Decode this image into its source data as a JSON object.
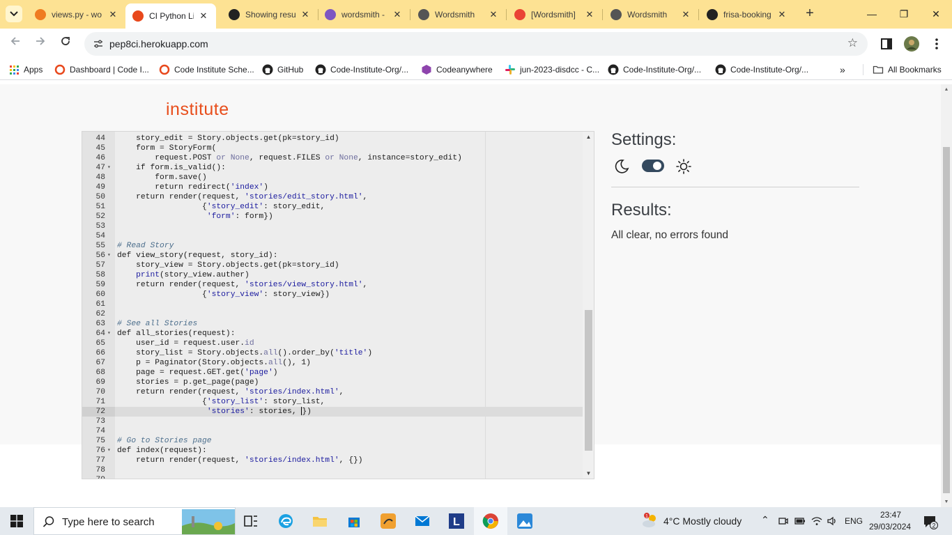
{
  "browser": {
    "tabs": [
      {
        "title": "views.py - wo",
        "favicon_color": "#ef7b21",
        "active": false
      },
      {
        "title": "CI Python Lin",
        "favicon_color": "#e8481c",
        "active": true
      },
      {
        "title": "Showing resu",
        "favicon_color": "#222222",
        "active": false
      },
      {
        "title": "wordsmith -",
        "favicon_color": "#7e57c2",
        "active": false
      },
      {
        "title": "Wordsmith",
        "favicon_color": "#555555",
        "active": false
      },
      {
        "title": "[Wordsmith]",
        "favicon_color": "#ea4335",
        "active": false
      },
      {
        "title": "Wordsmith",
        "favicon_color": "#555555",
        "active": false
      },
      {
        "title": "frisa-booking",
        "favicon_color": "#222222",
        "active": false
      }
    ],
    "url": "pep8ci.herokuapp.com",
    "bookmarks": [
      {
        "label": "Apps",
        "icon": "apps-grid-icon"
      },
      {
        "label": "Dashboard | Code I...",
        "icon": "code-institute-icon"
      },
      {
        "label": "Code Institute Sche...",
        "icon": "code-institute-icon"
      },
      {
        "label": "GitHub",
        "icon": "github-icon"
      },
      {
        "label": "Code-Institute-Org/...",
        "icon": "github-icon"
      },
      {
        "label": "Codeanywhere",
        "icon": "codeanywhere-icon"
      },
      {
        "label": "jun-2023-disdcc - C...",
        "icon": "slack-icon"
      },
      {
        "label": "Code-Institute-Org/...",
        "icon": "github-icon"
      },
      {
        "label": "Code-Institute-Org/...",
        "icon": "github-icon"
      }
    ],
    "all_bookmarks_label": "All Bookmarks",
    "overflow_label": "»"
  },
  "logo": {
    "word": "institute"
  },
  "editor": {
    "lines": [
      {
        "n": "44",
        "fold": false,
        "code": "    story_edit = Story.objects.get(pk=story_id)"
      },
      {
        "n": "45",
        "fold": false,
        "code": "    form = StoryForm("
      },
      {
        "n": "46",
        "fold": false,
        "code": "        request.POST or None, request.FILES or None, instance=story_edit)"
      },
      {
        "n": "47",
        "fold": true,
        "code": "    if form.is_valid():"
      },
      {
        "n": "48",
        "fold": false,
        "code": "        form.save()"
      },
      {
        "n": "49",
        "fold": false,
        "code": "        return redirect('index')"
      },
      {
        "n": "50",
        "fold": false,
        "code": "    return render(request, 'stories/edit_story.html',"
      },
      {
        "n": "51",
        "fold": false,
        "code": "                  {'story_edit': story_edit,"
      },
      {
        "n": "52",
        "fold": false,
        "code": "                   'form': form})"
      },
      {
        "n": "53",
        "fold": false,
        "code": ""
      },
      {
        "n": "54",
        "fold": false,
        "code": ""
      },
      {
        "n": "55",
        "fold": false,
        "code": "# Read Story"
      },
      {
        "n": "56",
        "fold": true,
        "code": "def view_story(request, story_id):"
      },
      {
        "n": "57",
        "fold": false,
        "code": "    story_view = Story.objects.get(pk=story_id)"
      },
      {
        "n": "58",
        "fold": false,
        "code": "    print(story_view.auther)"
      },
      {
        "n": "59",
        "fold": false,
        "code": "    return render(request, 'stories/view_story.html',"
      },
      {
        "n": "60",
        "fold": false,
        "code": "                  {'story_view': story_view})"
      },
      {
        "n": "61",
        "fold": false,
        "code": ""
      },
      {
        "n": "62",
        "fold": false,
        "code": ""
      },
      {
        "n": "63",
        "fold": false,
        "code": "# See all Stories"
      },
      {
        "n": "64",
        "fold": true,
        "code": "def all_stories(request):"
      },
      {
        "n": "65",
        "fold": false,
        "code": "    user_id = request.user.id"
      },
      {
        "n": "66",
        "fold": false,
        "code": "    story_list = Story.objects.all().order_by('title')"
      },
      {
        "n": "67",
        "fold": false,
        "code": "    p = Paginator(Story.objects.all(), 1)"
      },
      {
        "n": "68",
        "fold": false,
        "code": "    page = request.GET.get('page')"
      },
      {
        "n": "69",
        "fold": false,
        "code": "    stories = p.get_page(page)"
      },
      {
        "n": "70",
        "fold": false,
        "code": "    return render(request, 'stories/index.html',"
      },
      {
        "n": "71",
        "fold": false,
        "code": "                  {'story_list': story_list,"
      },
      {
        "n": "72",
        "fold": false,
        "code": "                   'stories': stories, })"
      },
      {
        "n": "73",
        "fold": false,
        "code": ""
      },
      {
        "n": "74",
        "fold": false,
        "code": ""
      },
      {
        "n": "75",
        "fold": false,
        "code": "# Go to Stories page"
      },
      {
        "n": "76",
        "fold": true,
        "code": "def index(request):"
      },
      {
        "n": "77",
        "fold": false,
        "code": "    return render(request, 'stories/index.html', {})"
      },
      {
        "n": "78",
        "fold": false,
        "code": ""
      },
      {
        "n": "79",
        "fold": false,
        "code": ""
      }
    ],
    "active_line": "72"
  },
  "settings": {
    "title": "Settings:",
    "theme_toggle_on": true
  },
  "results": {
    "title": "Results:",
    "message": "All clear, no errors found"
  },
  "taskbar": {
    "search_placeholder": "Type here to search",
    "weather": "4°C  Mostly cloudy",
    "weather_badge": "1",
    "language": "ENG",
    "time": "23:47",
    "date": "29/03/2024",
    "notification_count": "2"
  }
}
